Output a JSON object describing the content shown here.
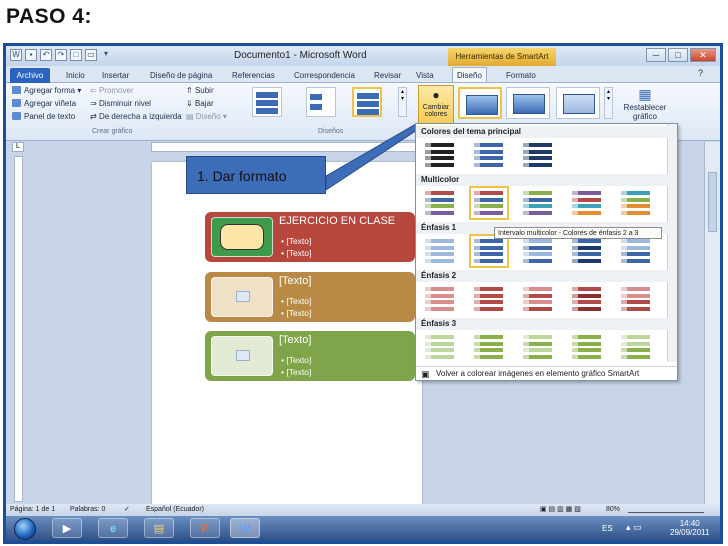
{
  "heading": "PASO 4:",
  "window": {
    "title": "Documento1 - Microsoft Word",
    "contextual_tab": "Herramientas de SmartArt",
    "min": "─",
    "max": "□",
    "close": "✕"
  },
  "tabs": [
    "Archivo",
    "Inicio",
    "Insertar",
    "Diseño de página",
    "Referencias",
    "Correspondencia",
    "Revisar",
    "Vista",
    "Diseño",
    "Formato"
  ],
  "ribbon": {
    "crear_grafico": {
      "items": [
        "Agregar forma",
        "Agregar viñeta",
        "Panel de texto",
        "Promover",
        "Disminuir nivel",
        "De derecha a izquierda",
        "Subir",
        "Bajar",
        "Diseño"
      ],
      "label": "Crear gráfico"
    },
    "disenos_label": "Diseños",
    "cambiar_colores": [
      "Cambiar",
      "colores"
    ],
    "restablecer": [
      "Restablecer",
      "gráfico"
    ]
  },
  "document": {
    "smartart": [
      {
        "title": "EJERCICIO EN CLASE",
        "bullets": [
          "[Texto]",
          "[Texto]"
        ],
        "color": "#b7463c"
      },
      {
        "title": "[Texto]",
        "bullets": [
          "[Texto]",
          "[Texto]"
        ],
        "color": "#b88a46"
      },
      {
        "title": "[Texto]",
        "bullets": [
          "[Texto]",
          "[Texto]"
        ],
        "color": "#7fa44a"
      }
    ],
    "callout": "1. Dar formato"
  },
  "color_menu": {
    "sections": [
      "Colores del tema principal",
      "Multicolor",
      "Énfasis 1",
      "Énfasis 2",
      "Énfasis 3"
    ],
    "tooltip": "Intervalo multicolor - Colores de énfasis 2 a 3",
    "footer": "Volver a colorear imágenes en elemento gráfico SmartArt",
    "colors": {
      "dark": "#222222",
      "blue": "#3c66a8",
      "navy": "#1f3a68",
      "red": "#b24a48",
      "green": "#8ab04c",
      "purple": "#7a5c9c",
      "teal": "#3ea0b8",
      "orange": "#e58b32",
      "lightblue": "#9cb8de",
      "pink": "#d88f8c",
      "lightgreen": "#bcd79c",
      "darkred": "#8a302d"
    }
  },
  "statusbar": {
    "page": "Página: 1 de 1",
    "words": "Palabras: 0",
    "lang": "Español (Ecuador)",
    "zoom": "80%"
  },
  "taskbar": {
    "lang": "ES",
    "time": "14:40",
    "date": "29/09/2011"
  }
}
